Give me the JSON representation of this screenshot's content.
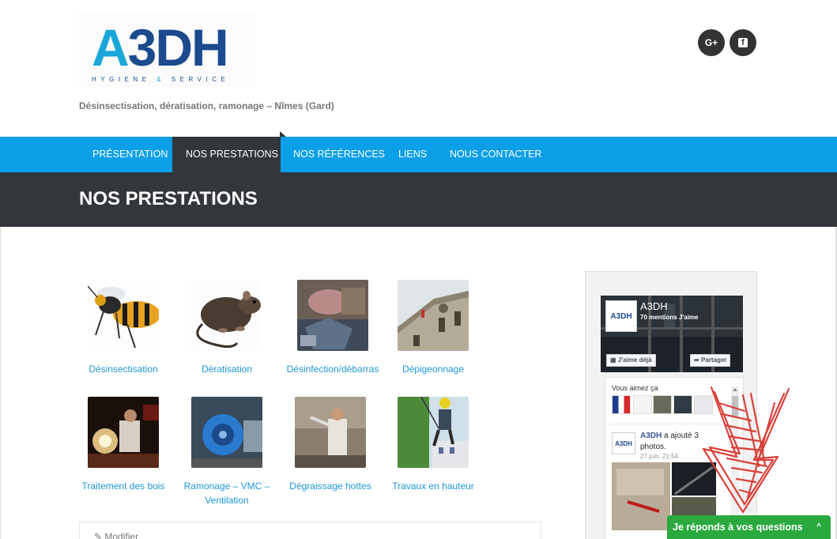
{
  "brand": {
    "logo_letter_a": "A",
    "logo_letters_rest": "3DH",
    "logo_subtitle_part1": "HYGIENE",
    "logo_subtitle_amp": "&",
    "logo_subtitle_part2": "SERVICE",
    "tagline": "Désinsectisation, dératisation, ramonage – Nîmes (Gard)"
  },
  "social": [
    {
      "name": "google-plus",
      "label": "G+"
    },
    {
      "name": "facebook",
      "label": "f"
    }
  ],
  "nav": {
    "items": [
      {
        "label": "Présentation"
      },
      {
        "label": "Nos prestations"
      },
      {
        "label": "Nos références"
      },
      {
        "label": "Liens"
      },
      {
        "label": "Nous contacter"
      }
    ],
    "active_index": 1
  },
  "page_title": "NOS PRESTATIONS",
  "services": [
    {
      "label": "Désinsectisation",
      "icon": "wasp-image"
    },
    {
      "label": "Dératisation",
      "icon": "rat-image"
    },
    {
      "label": "Désinfection/débarras",
      "icon": "debris-image"
    },
    {
      "label": "Dépigeonnage",
      "icon": "building-image"
    },
    {
      "label": "Traitement des bois",
      "icon": "wood-treatment-image"
    },
    {
      "label": "Ramonage – VMC – Ventilation",
      "icon": "vmc-image"
    },
    {
      "label": "Dégraissage hottes",
      "icon": "hood-cleaning-image"
    },
    {
      "label": "Travaux en hauteur",
      "icon": "rope-access-image"
    }
  ],
  "edit": {
    "label": "Modifier"
  },
  "facebook_widget": {
    "page_name": "A3DH",
    "likes": "70 mentions J'aime",
    "like_button": "J'aime déjà",
    "share_button": "Partager",
    "friends_label": "Vous aimez ça",
    "post_author": "A3DH",
    "post_action": " a ajouté 3 photos.",
    "post_time": "27 juin, 21:54",
    "avatar_label": "A3DH"
  },
  "chat": {
    "label": "Je réponds à vos questions",
    "chevron": "^"
  },
  "colors": {
    "nav_blue": "#0b9fe7",
    "dark_bar": "#33363b",
    "link_blue": "#1e97d6",
    "chat_green": "#2aa93e",
    "logo_cyan": "#1aa7d8",
    "logo_navy": "#1b4a8e"
  }
}
